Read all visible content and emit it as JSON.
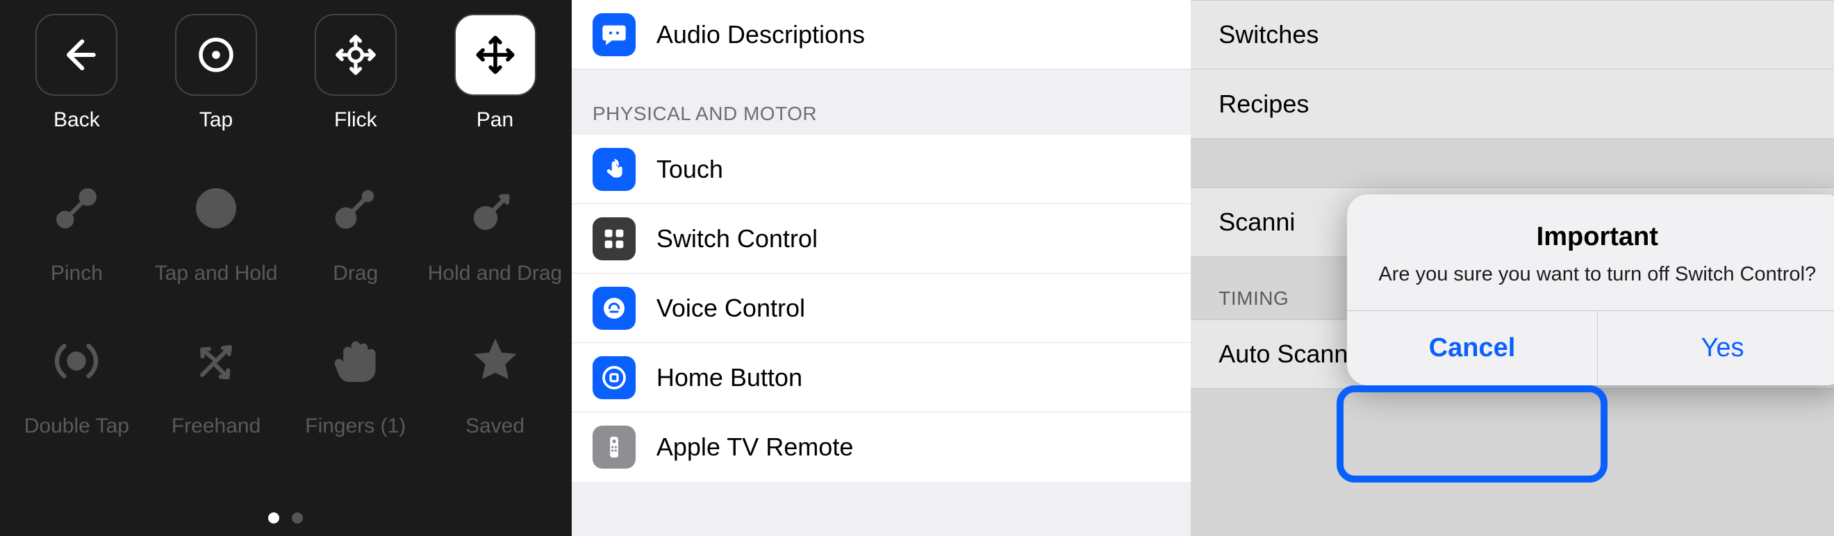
{
  "panel1": {
    "row1": [
      {
        "name": "back",
        "label": "Back",
        "icon": "arrow-left"
      },
      {
        "name": "tap",
        "label": "Tap",
        "icon": "circle-dot"
      },
      {
        "name": "flick",
        "label": "Flick",
        "icon": "flick"
      },
      {
        "name": "pan",
        "label": "Pan",
        "icon": "pan",
        "active": true
      }
    ],
    "row2": [
      {
        "name": "pinch",
        "label": "Pinch",
        "icon": "pinch"
      },
      {
        "name": "tap-and-hold",
        "label": "Tap and Hold",
        "icon": "target"
      },
      {
        "name": "drag",
        "label": "Drag",
        "icon": "drag"
      },
      {
        "name": "hold-and-drag",
        "label": "Hold and Drag",
        "icon": "hold-drag"
      }
    ],
    "row3": [
      {
        "name": "double-tap",
        "label": "Double Tap",
        "icon": "double-tap"
      },
      {
        "name": "freehand",
        "label": "Freehand",
        "icon": "freehand"
      },
      {
        "name": "fingers-1",
        "label": "Fingers (1)",
        "icon": "hand"
      },
      {
        "name": "saved",
        "label": "Saved",
        "icon": "star"
      }
    ],
    "page_dots": {
      "current": 0,
      "total": 2
    }
  },
  "panel2": {
    "top_rows": [
      {
        "name": "audio-descriptions",
        "label": "Audio Descriptions",
        "icon": "speech-bubble",
        "color": "#0a60ff"
      }
    ],
    "section_header": "PHYSICAL AND MOTOR",
    "motor_rows": [
      {
        "name": "touch",
        "label": "Touch",
        "icon": "touch",
        "color": "#0a60ff"
      },
      {
        "name": "switch-control",
        "label": "Switch Control",
        "icon": "grid4",
        "color": "#3a3a3c"
      },
      {
        "name": "voice-control",
        "label": "Voice Control",
        "icon": "voice",
        "color": "#0a60ff"
      },
      {
        "name": "home-button",
        "label": "Home Button",
        "icon": "home-btn",
        "color": "#0a60ff"
      },
      {
        "name": "apple-tv-remote",
        "label": "Apple TV Remote",
        "icon": "remote",
        "color": "#8e8e93"
      }
    ]
  },
  "panel3": {
    "rows_top": [
      {
        "name": "switches",
        "label": "Switches"
      },
      {
        "name": "recipes",
        "label": "Recipes"
      }
    ],
    "scanning_label": "Scanni",
    "timing_header": "TIMING",
    "auto_scanning_label": "Auto Scanning Time",
    "alert": {
      "title": "Important",
      "message": "Are you sure you want to turn off Switch Control?",
      "cancel": "Cancel",
      "confirm": "Yes"
    }
  }
}
